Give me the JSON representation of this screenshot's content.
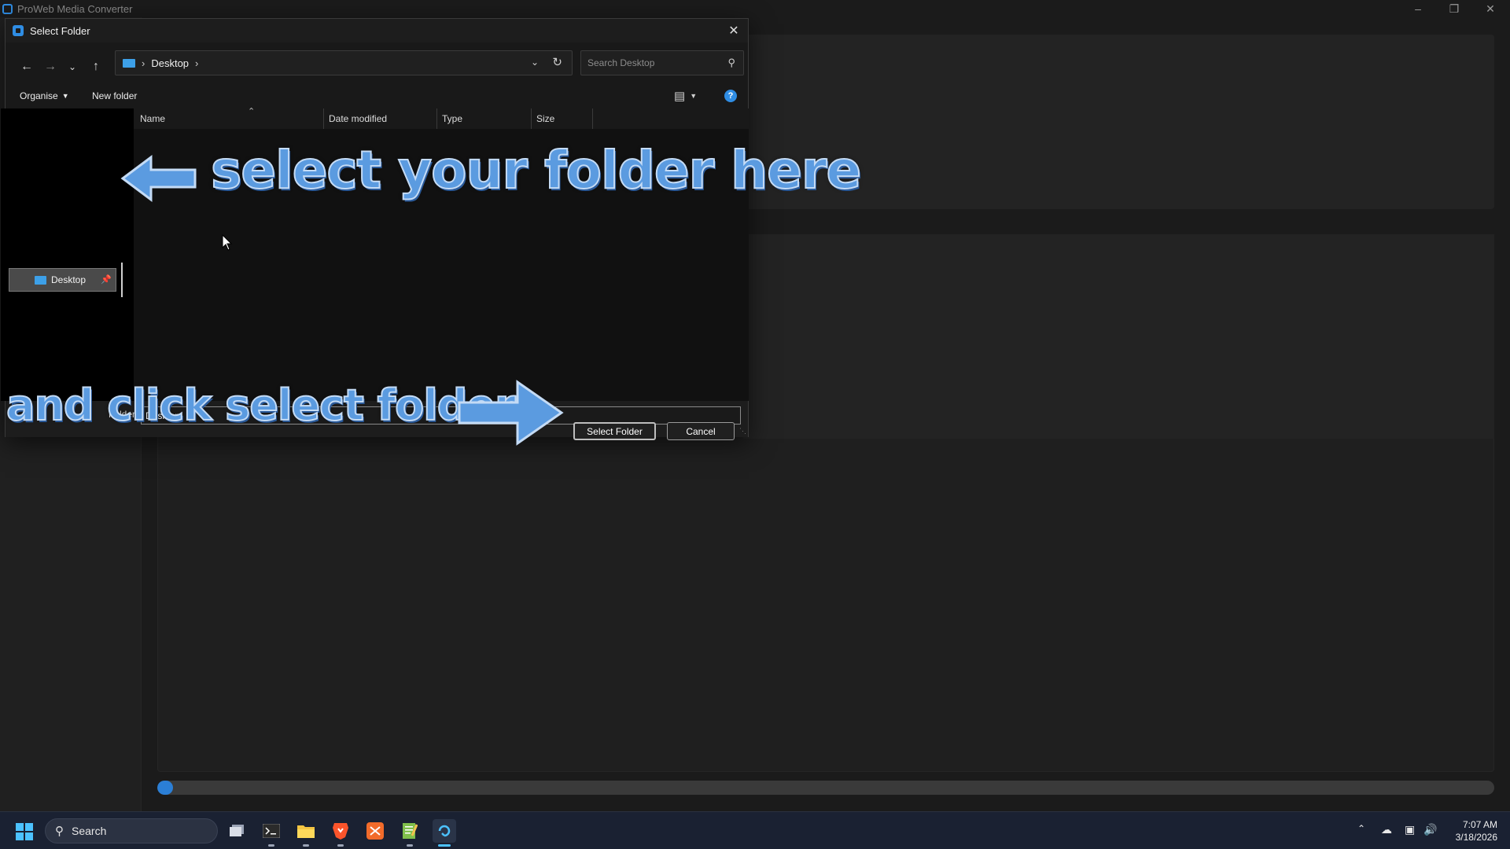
{
  "app": {
    "title": "ProWeb Media Converter",
    "progress_fraction": 0.01,
    "accent": "#2f8de4"
  },
  "dialog": {
    "title": "Select Folder",
    "address": {
      "crumb": "Desktop",
      "sep": "›"
    },
    "search": {
      "placeholder": "Search Desktop"
    },
    "commands": {
      "organise": "Organise",
      "new_folder": "New folder",
      "help": "?"
    },
    "nav_pane": {
      "items": [
        {
          "label": "Desktop",
          "selected": true,
          "pinned": true
        }
      ]
    },
    "columns": [
      "Name",
      "Date modified",
      "Type",
      "Size"
    ],
    "folder_label": "Folder:",
    "folder_value": "Desktop",
    "buttons": {
      "select": "Select Folder",
      "cancel": "Cancel"
    }
  },
  "annotations": {
    "top": "select your folder here",
    "bottom": "and click select folder"
  },
  "taskbar": {
    "search_label": "Search",
    "apps": [
      "task-view",
      "terminal",
      "file-explorer",
      "brave-browser",
      "app-orange",
      "notepad",
      "proweb-media-converter"
    ],
    "time": "7:07 AM",
    "date": "3/18/2026"
  }
}
